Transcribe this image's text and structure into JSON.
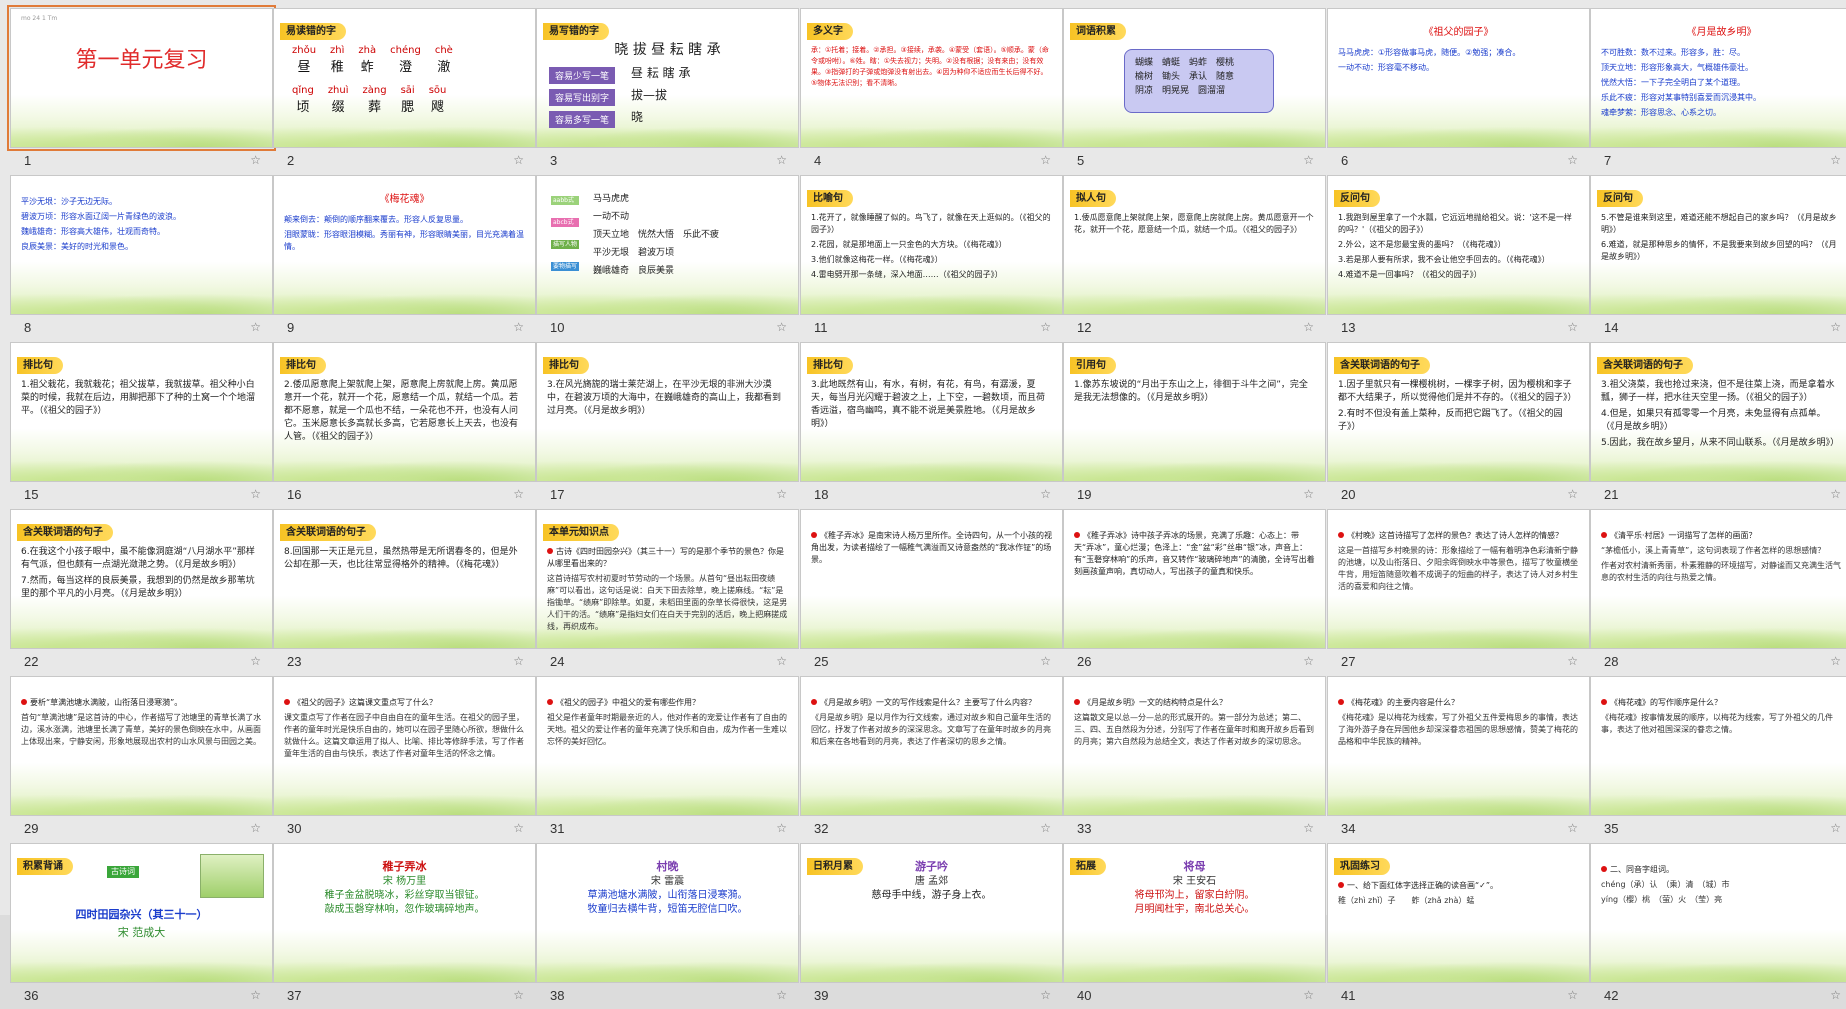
{
  "window": {
    "mode": "slide-sorter"
  },
  "slides": [
    {
      "n": "1",
      "tag": "",
      "title": "第一单元复习",
      "header": "mo 24 1 Tm"
    },
    {
      "n": "2",
      "tag": "易读错的字",
      "row1": [
        {
          "py": "zhǒu",
          "hz": "昼"
        },
        {
          "py": "zhì",
          "hz": "稚"
        },
        {
          "py": "zhà",
          "hz": "蚱"
        },
        {
          "py": "chéng",
          "hz": "澄"
        },
        {
          "py": "chè",
          "hz": "澈"
        }
      ],
      "row2": [
        {
          "py": "qǐng",
          "hz": "顷"
        },
        {
          "py": "zhuì",
          "hz": "缀"
        },
        {
          "py": "zàng",
          "hz": "葬"
        },
        {
          "py": "sāi",
          "hz": "腮"
        },
        {
          "py": "sōu",
          "hz": "飕"
        }
      ]
    },
    {
      "n": "3",
      "tag": "易写错的字",
      "chars": "晓 拔 昼 耘 瞎 承",
      "lines": [
        {
          "label": "容易少写一笔",
          "val": "昼 耘 瞎 承"
        },
        {
          "label": "容易写出别字",
          "val": "拔—拔"
        },
        {
          "label": "容易多写一笔",
          "val": "晓"
        }
      ]
    },
    {
      "n": "4",
      "tag": "多义字",
      "text": "承：①托着；接着。②承担。③接续，承袭。④蒙受（套语）。⑤顺承。蒙（命令或吩咐）。⑥姓。瞎：①失去视力；失明。②没有根据；没有来由；没有效果。③指弹打的子弹或炮弹没有射出去。④因为种仰不适应而生长后得不好。⑤物体无法识别；看不清晰。"
    },
    {
      "n": "5",
      "tag": "词语积累",
      "idioms": "蝴蝶　蜻蜓　蚂蚱　樱桃\n榆树　锄头　承认　随意\n阴凉　明晃晃　圆溜溜"
    },
    {
      "n": "6",
      "heading": "《祖父的园子》",
      "lines": [
        "马马虎虎：①形容做事马虎，随便。②勉强；凑合。",
        "一动不动：形容毫不移动。"
      ]
    },
    {
      "n": "7",
      "heading": "《月是故乡明》",
      "lines": [
        "不可胜数：数不过来。形容多，胜：尽。",
        "顶天立地：形容形象高大，气概雄伟豪壮。",
        "恍然大悟：一下子完全明白了某个道理。",
        "乐此不疲：形容对某事特别喜爱而沉浸其中。",
        "魂牵梦萦：形容思念、心系之切。"
      ]
    },
    {
      "n": "8",
      "lines": [
        "平沙无垠：沙子无边无际。",
        "碧波万顷：形容水面辽阔一片青绿色的波浪。",
        "魏峨雄奇：形容高大雄伟，壮观而奇特。",
        "良辰美景：美好的时光和景色。"
      ]
    },
    {
      "n": "9",
      "heading": "《梅花魂》",
      "lines": [
        "颠来倒去：颠倒的顺序翻来覆去。形容人反复思量。",
        "泪眼蒙眬：形容眼泪模糊。秀丽有神，形容眼睛美丽，目光充满着温情。"
      ]
    },
    {
      "n": "10",
      "legend": [
        "aabb式",
        "abcb式",
        "描写人物",
        "要物描写"
      ],
      "lines": [
        "马马虎虎",
        "一动不动",
        "顶天立地　恍然大悟　乐此不疲",
        "平沙无垠　碧波万顷",
        "巍峨雄奇　良辰美景"
      ]
    },
    {
      "n": "11",
      "tag": "比喻句",
      "lines": [
        "1.花开了，就像睡醒了似的。鸟飞了，就像在天上逛似的。（《祖父的园子》）",
        "2.花园，就是那地面上一只金色的大方块。（《梅花魂》）",
        "3.他们就像这梅花一样。（《梅花魂》）",
        "4.雷电劈开那一条缝，深入地面……（《祖父的园子》）"
      ]
    },
    {
      "n": "12",
      "tag": "拟人句",
      "lines": [
        "1.倭瓜愿意爬上架就爬上架，愿意爬上房就爬上房。黄瓜愿意开一个花，就开一个花，愿意结一个瓜，就结一个瓜。（《祖父的园子》）"
      ]
    },
    {
      "n": "13",
      "tag": "反问句",
      "lines": [
        "1.我跑到屋里拿了一个水瓢，它远远地抛给祖父。说：'这不是一样的吗？'（《祖父的园子》）",
        "2.外公，这不是您最宝贵的墨吗？（《梅花魂》）",
        "3.若是那人要有所求，我不会让他空手回去的。（《梅花魂》）",
        "4.难道不是一回事吗？（《祖父的园子》）"
      ]
    },
    {
      "n": "14",
      "tag": "反问句",
      "lines": [
        "5.不管是谁来到这里，难道还能不想起自己的家乡吗？（《月是故乡明》）",
        "6.难道，就是那种思乡的情怀，不是我要来到故乡回望的吗？（《月是故乡明》）"
      ]
    },
    {
      "n": "15",
      "tag": "排比句",
      "lines": [
        "1.祖父栽花，我就栽花；祖父拔草，我就拔草。祖父种小白菜的时候，我就在后边，用脚把那下了种的土窝一个个地溜平。（《祖父的园子》）"
      ]
    },
    {
      "n": "16",
      "tag": "排比句",
      "lines": [
        "2.倭瓜愿意爬上架就爬上架，愿意爬上房就爬上房。黄瓜愿意开一个花，就开一个花，愿意结一个瓜，就结一个瓜。若都不愿意，就是一个瓜也不结，一朵花也不开，也没有人问它。玉米愿意长多高就长多高，它若愿意长上天去，也没有人管。（《祖父的园子》）"
      ]
    },
    {
      "n": "17",
      "tag": "排比句",
      "lines": [
        "3.在风光旖旎的瑞士莱茫湖上，在平沙无垠的非洲大沙漠中，在碧波万顷的大海中，在巍峨雄奇的高山上，我都看到过月亮。（《月是故乡明》）"
      ]
    },
    {
      "n": "18",
      "tag": "排比句",
      "lines": [
        "3.此地既然有山，有水，有树，有花，有鸟，有潺湲，夏天，每当月光闪耀于碧波之上，上下空，一碧数顷，而且荷香远溢，宿鸟幽鸣，真不能不说是美景胜地。（《月是故乡明》）"
      ]
    },
    {
      "n": "19",
      "tag": "引用句",
      "lines": [
        "1.像苏东坡说的“月出于东山之上，徘徊于斗牛之间”，完全是我无法想像的。（《月是故乡明》）"
      ]
    },
    {
      "n": "20",
      "tag": "含关联词语的句子",
      "lines": [
        "1.因子里就只有一棵樱桃树，一棵李子树，因为樱桃和李子都不大结果子，所以觉得他们是并不存的。（《祖父的园子》）",
        "2.有时不但没有盖上菜种，反而把它踢飞了。（《祖父的园子》）"
      ]
    },
    {
      "n": "21",
      "tag": "含关联词语的句子",
      "lines": [
        "3.祖父浇菜，我也抢过来浇，但不是往菜上浇，而是拿着水瓢，狮子一样，把水往天空里一扬。（《祖父的园子》）",
        "4.但是，如果只有孤零零一个月亮，未免显得有点孤单。（《月是故乡明》）",
        "5.因此，我在故乡望月，从来不同山联系。（《月是故乡明》）"
      ]
    },
    {
      "n": "22",
      "tag": "含关联词语的句子",
      "lines": [
        "6.在我这个小孩子眼中，虽不能像洞庭湖“八月湖水平”那样有气派，但也颇有一点湖光潋滟之势。（《月是故乡明》）",
        "7.然而，每当这样的良辰美景，我想到的仍然是故乡那苇坑里的那个平凡的小月亮。（《月是故乡明》）"
      ]
    },
    {
      "n": "23",
      "tag": "含关联词语的句子",
      "lines": [
        "8.回国那一天正是元旦，虽然热带是无所谓春冬的，但是外公却在那一天，也比往常显得格外的精神。（《梅花魂》）"
      ]
    },
    {
      "n": "24",
      "tag": "本单元知识点",
      "lines": [
        "古诗《四时田园杂兴》（其三十一）写的是那个季节的景色？你是从哪里看出来的？",
        "这首诗描写农村初夏时节劳动的一个场景。从首句“昼出耘田夜绩麻”可以看出，这句话是说：白天下田去除草，晚上搓麻线。“耘”是指锄草。“绩麻”即除草。如夏，未稻田里面的杂草长得很快，这是男人们干的活。“绩麻”是指妇女们在白天于完别的活后，晚上把麻搓成线，再织成布。"
      ]
    },
    {
      "n": "25",
      "lines": [
        "《稚子弄冰》是南宋诗人杨万里所作。全诗四句，从一个小孩的视角出发，为读者描绘了一幅稚气满溢而又诗意盎然的“我冰作钲”的场景。"
      ]
    },
    {
      "n": "26",
      "lines": [
        "《稚子弄冰》诗中孩子弄冰的场景，充满了乐趣：心态上：带天“弄冰”，童心烂漫；色泽上：“金”盆“彩”丝串“银”冰，声音上：有“玉磬穿林响”的乐声，音又转作“玻璃碎地声”的清脆，全诗写出着刻画孩童声响，真切动人，写出孩子的童真和快乐。"
      ]
    },
    {
      "n": "27",
      "lines": [
        "《村晚》这首诗描写了怎样的景色？表达了诗人怎样的情感？",
        "这是一首描写乡村晚景的诗：形象描绘了一幅有着明净色彩清新宁静的池塘，以及山衔落日、夕阳余晖倒映水中等景色，描写了牧童横坐牛背，用短笛随意吹着不成调子的短曲的样子，表达了诗人对乡村生活的喜爱和向往之情。"
      ]
    },
    {
      "n": "28",
      "lines": [
        "《清平乐·村居》一词描写了怎样的画面？",
        "“茅檐低小，溪上青青草”，这句词表现了作者怎样的思想感情？",
        "作者对农村清新秀丽，朴素雅静的环境描写，对静谧而又充满生活气息的农村生活的向往与热爱之情。"
      ]
    },
    {
      "n": "29",
      "lines": [
        "要析“草满池塘水满陂，山衔落日浸寒漪”。",
        "首句“草满池塘”是这首诗的中心，作者描写了池塘里的青草长满了水边，溪水涨满，池塘里长满了青草，美好的景色倒映在水中，从画面上体现出来，宁静安闲，形象地展现出农村的山水风景与田园之美。"
      ]
    },
    {
      "n": "30",
      "lines": [
        "《祖父的园子》这篇课文重点写了什么？",
        "课文重点写了作者在园子中自由自在的童年生活。在祖父的园子里，作者的童年时光是快乐自由的，她可以在园子里随心所欲，想做什么就做什么。这篇文章运用了拟人、比喻、排比等修辞手法，写了作者童年生活的自由与快乐，表达了作者对童年生活的怀念之情。"
      ]
    },
    {
      "n": "31",
      "lines": [
        "《祖父的园子》中祖父的爱有哪些作用？",
        "祖父是作者童年时期最亲近的人，他对作者的宠爱让作者有了自由的天地。祖父的爱让作者的童年充满了快乐和自由，成为作者一生难以忘怀的美好回忆。"
      ]
    },
    {
      "n": "32",
      "lines": [
        "《月是故乡明》一文的写作线索是什么？主要写了什么内容？",
        "《月是故乡明》是以月作为行文线索，通过对故乡和自己童年生活的回忆，抒发了作者对故乡的深深思念。文章写了在童年时故乡的月亮和后来在各地看到的月亮，表达了作者深切的思乡之情。"
      ]
    },
    {
      "n": "33",
      "lines": [
        "《月是故乡明》一文的结构特点是什么？",
        "这篇散文是以总—分—总的形式展开的。第一部分为总述；第二、三、四、五自然段为分述，分别写了作者在童年时和离开故乡后看到的月亮；第六自然段为总结全文，表达了作者对故乡的深切思念。"
      ]
    },
    {
      "n": "34",
      "lines": [
        "《梅花魂》的主要内容是什么？",
        "《梅花魂》是以梅花为线索，写了外祖父五件爱梅思乡的事情，表达了海外游子身在异国他乡却深深眷恋祖国的思想感情，赞美了梅花的品格和中华民族的精神。"
      ]
    },
    {
      "n": "35",
      "lines": [
        "《梅花魂》的写作顺序是什么？",
        "《梅花魂》按事情发展的顺序，以梅花为线索，写了外祖父的几件事，表达了他对祖国深深的眷恋之情。"
      ]
    },
    {
      "n": "36",
      "tag": "积累背诵",
      "badge": "古诗词",
      "title": "四时田园杂兴（其三十一）",
      "author": "宋 范成大"
    },
    {
      "n": "37",
      "title": "稚子弄冰",
      "author": "宋 杨万里",
      "lines": [
        "稚子金盆脱晓冰，彩丝穿取当银钲。",
        "敲成玉磬穿林响，忽作玻璃碎地声。"
      ]
    },
    {
      "n": "38",
      "title": "村晚",
      "author": "宋 雷震",
      "lines": [
        "草满池塘水满陂，山衔落日浸寒漪。",
        "牧童归去横牛背，短笛无腔信口吹。"
      ]
    },
    {
      "n": "39",
      "tag": "日积月累",
      "title": "游子吟",
      "author": "唐 孟郊",
      "lines": [
        "慈母手中线，游子身上衣。"
      ]
    },
    {
      "n": "40",
      "tag": "拓展",
      "title": "将母",
      "author": "宋 王安石",
      "lines": [
        "将母邗沟上，留家白紵阴。",
        "月明闻杜宇，南北总关心。"
      ]
    },
    {
      "n": "41",
      "tag": "巩固练习",
      "lines": [
        "一、给下面红体字选择正确的读音画“✓”。",
        "稚（zhì zhǐ）子　　蚱（zhǎ zhà）蜢"
      ]
    },
    {
      "n": "42",
      "lines": [
        "二、同音字组词。",
        "chéng（承）认　（乘）清　（城）市",
        "yíng（樱）桃　（萤）火　（莹）亮"
      ]
    }
  ],
  "labels": {
    "n1": "1",
    "n2": "2",
    "n3": "3",
    "n4": "4",
    "n5": "5",
    "n6": "6",
    "n7": "7",
    "n8": "8",
    "n9": "9",
    "n10": "10",
    "n11": "11",
    "n12": "12",
    "n13": "13",
    "n14": "14",
    "n15": "15",
    "n16": "16",
    "n17": "17",
    "n18": "18",
    "n19": "19",
    "n20": "20",
    "n21": "21",
    "n22": "22",
    "n23": "23",
    "n24": "24",
    "n25": "25",
    "n26": "26",
    "n27": "27",
    "n28": "28",
    "n29": "29",
    "n30": "30",
    "n31": "31",
    "n32": "32",
    "n33": "33",
    "n34": "34",
    "n35": "35"
  }
}
